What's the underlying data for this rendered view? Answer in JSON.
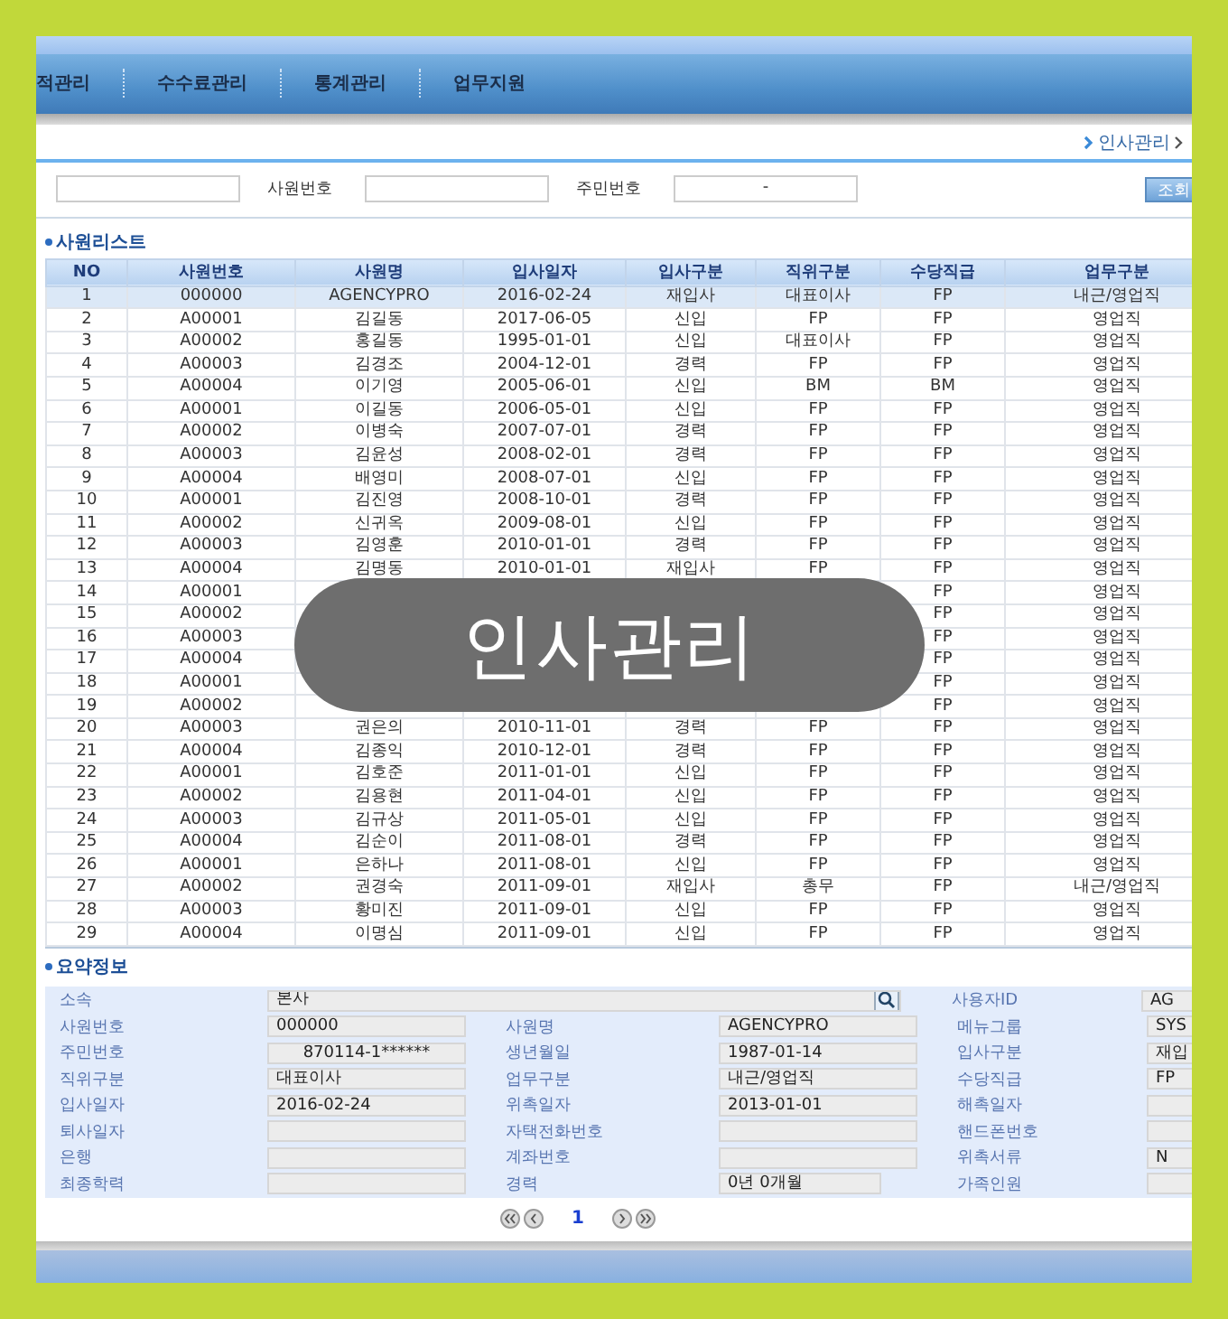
{
  "nav": {
    "items": [
      "적관리",
      "수수료관리",
      "통계관리",
      "업무지원"
    ]
  },
  "breadcrumb": {
    "label": "인사관리"
  },
  "search": {
    "fields": [
      {
        "label": "사원번호"
      },
      {
        "label": "주민번호",
        "value": "-"
      }
    ],
    "button": "조회"
  },
  "employee_list": {
    "title": "사원리스트",
    "columns": [
      "NO",
      "사원번호",
      "사원명",
      "입사일자",
      "입사구분",
      "직위구분",
      "수당직급",
      "업무구분"
    ],
    "rows": [
      {
        "selected": true,
        "cells": [
          "1",
          "000000",
          "AGENCYPRO",
          "2016-02-24",
          "재입사",
          "대표이사",
          "FP",
          "내근/영업직"
        ]
      },
      {
        "selected": false,
        "cells": [
          "2",
          "A00001",
          "김길동",
          "2017-06-05",
          "신입",
          "FP",
          "FP",
          "영업직"
        ]
      },
      {
        "selected": false,
        "cells": [
          "3",
          "A00002",
          "홍길동",
          "1995-01-01",
          "신입",
          "대표이사",
          "FP",
          "영업직"
        ]
      },
      {
        "selected": false,
        "cells": [
          "4",
          "A00003",
          "김경조",
          "2004-12-01",
          "경력",
          "FP",
          "FP",
          "영업직"
        ]
      },
      {
        "selected": false,
        "cells": [
          "5",
          "A00004",
          "이기영",
          "2005-06-01",
          "신입",
          "BM",
          "BM",
          "영업직"
        ]
      },
      {
        "selected": false,
        "cells": [
          "6",
          "A00001",
          "이길동",
          "2006-05-01",
          "신입",
          "FP",
          "FP",
          "영업직"
        ]
      },
      {
        "selected": false,
        "cells": [
          "7",
          "A00002",
          "이병숙",
          "2007-07-01",
          "경력",
          "FP",
          "FP",
          "영업직"
        ]
      },
      {
        "selected": false,
        "cells": [
          "8",
          "A00003",
          "김윤성",
          "2008-02-01",
          "경력",
          "FP",
          "FP",
          "영업직"
        ]
      },
      {
        "selected": false,
        "cells": [
          "9",
          "A00004",
          "배영미",
          "2008-07-01",
          "신입",
          "FP",
          "FP",
          "영업직"
        ]
      },
      {
        "selected": false,
        "cells": [
          "10",
          "A00001",
          "김진영",
          "2008-10-01",
          "경력",
          "FP",
          "FP",
          "영업직"
        ]
      },
      {
        "selected": false,
        "cells": [
          "11",
          "A00002",
          "신귀옥",
          "2009-08-01",
          "신입",
          "FP",
          "FP",
          "영업직"
        ]
      },
      {
        "selected": false,
        "cells": [
          "12",
          "A00003",
          "김영훈",
          "2010-01-01",
          "경력",
          "FP",
          "FP",
          "영업직"
        ]
      },
      {
        "selected": false,
        "cells": [
          "13",
          "A00004",
          "김명동",
          "2010-01-01",
          "재입사",
          "FP",
          "FP",
          "영업직"
        ]
      },
      {
        "selected": false,
        "cells": [
          "14",
          "A00001",
          null,
          null,
          null,
          null,
          "FP",
          "영업직"
        ]
      },
      {
        "selected": false,
        "cells": [
          "15",
          "A00002",
          null,
          null,
          null,
          null,
          "FP",
          "영업직"
        ]
      },
      {
        "selected": false,
        "cells": [
          "16",
          "A00003",
          null,
          null,
          null,
          null,
          "FP",
          "영업직"
        ]
      },
      {
        "selected": false,
        "cells": [
          "17",
          "A00004",
          null,
          null,
          null,
          null,
          "FP",
          "영업직"
        ]
      },
      {
        "selected": false,
        "cells": [
          "18",
          "A00001",
          null,
          null,
          null,
          null,
          "FP",
          "영업직"
        ]
      },
      {
        "selected": false,
        "cells": [
          "19",
          "A00002",
          null,
          null,
          null,
          null,
          "FP",
          "영업직"
        ]
      },
      {
        "selected": false,
        "cells": [
          "20",
          "A00003",
          "권은의",
          "2010-11-01",
          "경력",
          "FP",
          "FP",
          "영업직"
        ]
      },
      {
        "selected": false,
        "cells": [
          "21",
          "A00004",
          "김종익",
          "2010-12-01",
          "경력",
          "FP",
          "FP",
          "영업직"
        ]
      },
      {
        "selected": false,
        "cells": [
          "22",
          "A00001",
          "김호준",
          "2011-01-01",
          "신입",
          "FP",
          "FP",
          "영업직"
        ]
      },
      {
        "selected": false,
        "cells": [
          "23",
          "A00002",
          "김용현",
          "2011-04-01",
          "신입",
          "FP",
          "FP",
          "영업직"
        ]
      },
      {
        "selected": false,
        "cells": [
          "24",
          "A00003",
          "김규상",
          "2011-05-01",
          "신입",
          "FP",
          "FP",
          "영업직"
        ]
      },
      {
        "selected": false,
        "cells": [
          "25",
          "A00004",
          "김순이",
          "2011-08-01",
          "경력",
          "FP",
          "FP",
          "영업직"
        ]
      },
      {
        "selected": false,
        "cells": [
          "26",
          "A00001",
          "은하나",
          "2011-08-01",
          "신입",
          "FP",
          "FP",
          "영업직"
        ]
      },
      {
        "selected": false,
        "cells": [
          "27",
          "A00002",
          "권경숙",
          "2011-09-01",
          "재입사",
          "총무",
          "FP",
          "내근/영업직"
        ]
      },
      {
        "selected": false,
        "cells": [
          "28",
          "A00003",
          "황미진",
          "2011-09-01",
          "신입",
          "FP",
          "FP",
          "영업직"
        ]
      },
      {
        "selected": false,
        "cells": [
          "29",
          "A00004",
          "이명심",
          "2011-09-01",
          "신입",
          "FP",
          "FP",
          "영업직"
        ]
      }
    ]
  },
  "summary": {
    "title": "요약정보",
    "rows": [
      [
        {
          "label": "소속",
          "value": "본사",
          "kind": "lookup"
        },
        "",
        {
          "label": "사용자ID",
          "value": "AG"
        }
      ],
      [
        {
          "label": "사원번호",
          "value": "000000"
        },
        {
          "label": "사원명",
          "value": "AGENCYPRO"
        },
        {
          "label": "메뉴그룹",
          "value": "SYS"
        }
      ],
      [
        {
          "label": "주민번호",
          "value": "870114-1******",
          "kind": "centered"
        },
        {
          "label": "생년월일",
          "value": "1987-01-14"
        },
        {
          "label": "입사구분",
          "value": "재입"
        }
      ],
      [
        {
          "label": "직위구분",
          "value": "대표이사"
        },
        {
          "label": "업무구분",
          "value": "내근/영업직"
        },
        {
          "label": "수당직급",
          "value": "FP"
        }
      ],
      [
        {
          "label": "입사일자",
          "value": "2016-02-24"
        },
        {
          "label": "위촉일자",
          "value": "2013-01-01"
        },
        {
          "label": "해촉일자"
        }
      ],
      [
        {
          "label": "퇴사일자"
        },
        {
          "label": "자택전화번호"
        },
        {
          "label": "핸드폰번호"
        }
      ],
      [
        {
          "label": "은행"
        },
        {
          "label": "계좌번호"
        },
        {
          "label": "위촉서류",
          "value": "N"
        }
      ],
      [
        {
          "label": "최종학력"
        },
        {
          "label": "경력",
          "value": "0년  0개월"
        },
        {
          "label": "가족인원"
        }
      ]
    ]
  },
  "pagination": {
    "current": "1"
  },
  "caption": "인사관리"
}
